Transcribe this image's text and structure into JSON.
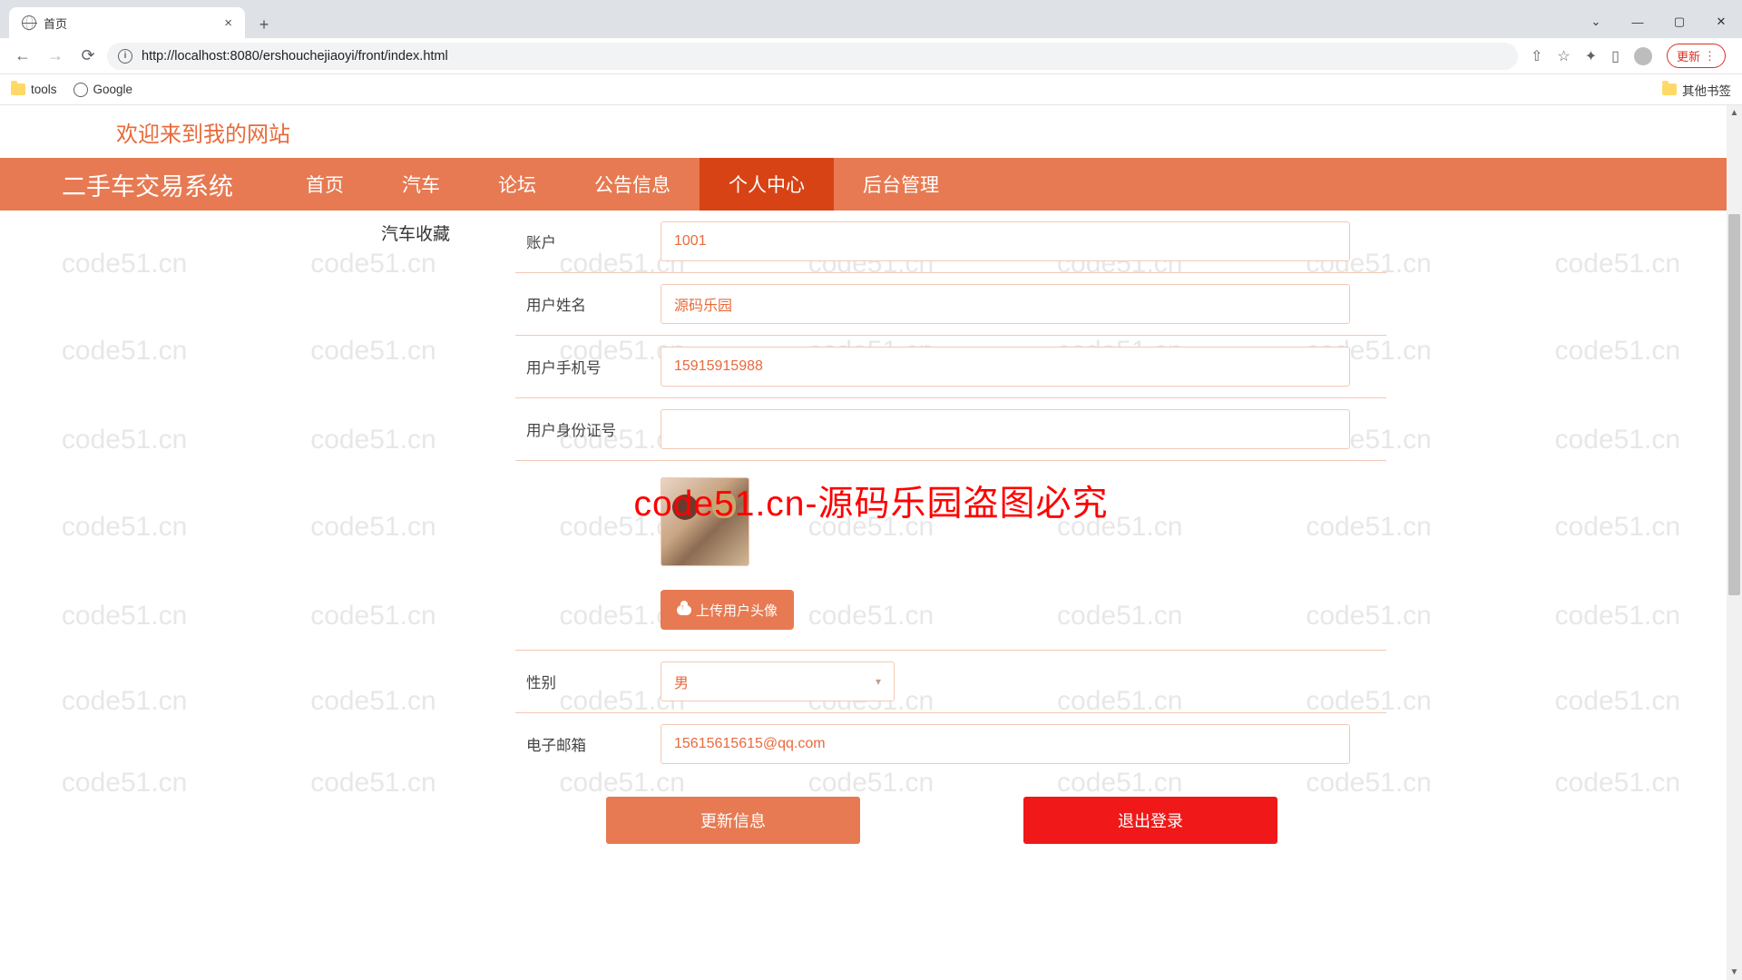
{
  "browser": {
    "tab_title": "首页",
    "url": "http://localhost:8080/ershouchejiaoyi/front/index.html",
    "new_tab": "+",
    "close": "×",
    "update_btn": "更新",
    "bookmarks": {
      "tools": "tools",
      "google": "Google",
      "other": "其他书签"
    }
  },
  "page": {
    "welcome": "欢迎来到我的网站",
    "brand": "二手车交易系统",
    "nav": {
      "home": "首页",
      "car": "汽车",
      "forum": "论坛",
      "notice": "公告信息",
      "center": "个人中心",
      "admin": "后台管理"
    },
    "side_tab": "汽车收藏"
  },
  "form": {
    "account": {
      "label": "账户",
      "value": "1001"
    },
    "username": {
      "label": "用户姓名",
      "value": "源码乐园"
    },
    "phone": {
      "label": "用户手机号",
      "value": "15915915988"
    },
    "idcard": {
      "label": "用户身份证号",
      "value": ""
    },
    "upload_btn": "上传用户头像",
    "gender": {
      "label": "性别",
      "value": "男"
    },
    "email": {
      "label": "电子邮箱",
      "value": "15615615615@qq.com"
    },
    "btn_update": "更新信息",
    "btn_logout": "退出登录"
  },
  "watermark": {
    "text": "code51.cn",
    "center": "code51.cn-源码乐园盗图必究"
  }
}
